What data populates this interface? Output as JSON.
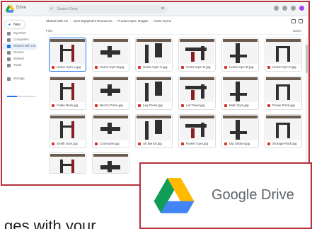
{
  "app": {
    "title": "Drive",
    "search_placeholder": "Search Drive"
  },
  "sidebar": {
    "new_label": "New",
    "items": [
      {
        "label": "My Drive"
      },
      {
        "label": "Computers"
      },
      {
        "label": "Shared with me"
      },
      {
        "label": "Recent"
      },
      {
        "label": "Starred"
      },
      {
        "label": "Trash"
      },
      {
        "label": "Storage"
      }
    ],
    "storage_used_fraction": 0.35
  },
  "breadcrumb": [
    "Shared with me",
    "Gym Equipment Resources",
    "Product Spec Images",
    "Home Gyms"
  ],
  "subbar": {
    "left": "Files",
    "right": "Name"
  },
  "files": [
    {
      "name": "Home Gym A.jpg"
    },
    {
      "name": "Home Gym B.jpg"
    },
    {
      "name": "Home Gym C.jpg"
    },
    {
      "name": "Home Gym D.jpg"
    },
    {
      "name": "Home Gym E.jpg"
    },
    {
      "name": "Home Gym F.jpg"
    },
    {
      "name": "Cable Rack.jpg"
    },
    {
      "name": "Bench Press.jpg"
    },
    {
      "name": "Leg Press.jpg"
    },
    {
      "name": "Lat Tower.jpg"
    },
    {
      "name": "Multi Gym.jpg"
    },
    {
      "name": "Power Rack.jpg"
    },
    {
      "name": "Smith Gym.jpg"
    },
    {
      "name": "Crossover.jpg"
    },
    {
      "name": "Ab Bench.jpg"
    },
    {
      "name": "Rower Gym.jpg"
    },
    {
      "name": "Dip Station.jpg"
    },
    {
      "name": "Storage Rack.jpg"
    },
    {
      "name": "Bar Set.jpg"
    },
    {
      "name": "Plate Set.jpg"
    }
  ],
  "badge": {
    "product_name": "Google Drive"
  },
  "caption": "ges with your"
}
